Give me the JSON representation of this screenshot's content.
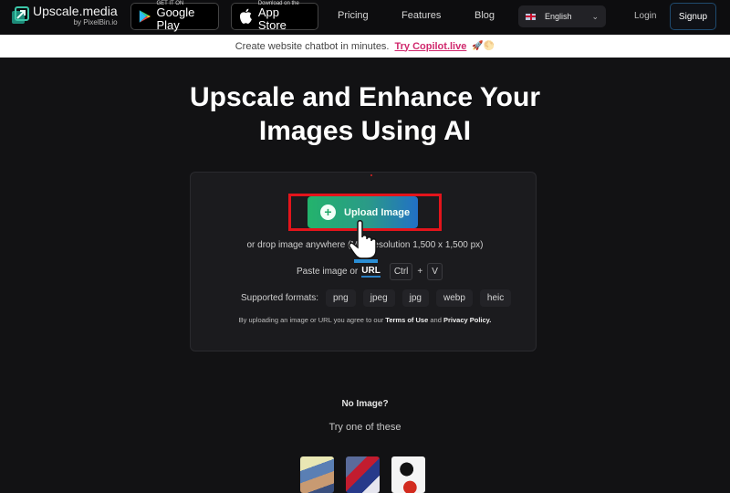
{
  "nav": {
    "logo_title": "Upscale.media",
    "logo_sub": "by PixelBin.io",
    "google_play": {
      "small": "GET IT ON",
      "big": "Google Play"
    },
    "app_store": {
      "small": "Download on the",
      "big": "App Store"
    },
    "links": [
      "Pricing",
      "Features",
      "Blog"
    ],
    "language": "English",
    "login": "Login",
    "signup": "Signup"
  },
  "banner": {
    "text": "Create website chatbot in minutes.",
    "link": "Try Copilot.live",
    "emoji": "🚀🌕"
  },
  "hero": {
    "line1": "Upscale and Enhance Your",
    "line2": "Images Using AI"
  },
  "upload": {
    "button_label": "Upload Image",
    "drop_text": "or drop image anywhere (Max resolution 1,500 x 1,500 px)",
    "paste_text": "Paste image or",
    "url_label": "URL",
    "key_ctrl": "Ctrl",
    "key_plus": "+",
    "key_v": "V",
    "formats_label": "Supported formats:",
    "formats": [
      "png",
      "jpeg",
      "jpg",
      "webp",
      "heic"
    ],
    "terms_prefix": "By uploading an image or URL you agree to our",
    "terms_link": "Terms of Use",
    "terms_and": "and",
    "privacy_link": "Privacy Policy."
  },
  "samples": {
    "title": "No Image?",
    "subtitle": "Try one of these",
    "images": [
      "sample-ape",
      "sample-robot",
      "sample-mickey"
    ]
  },
  "colors": {
    "accent_green": "#23b36c",
    "accent_blue": "#2270c6",
    "highlight_red": "#e3141b",
    "banner_link": "#d0286d"
  }
}
